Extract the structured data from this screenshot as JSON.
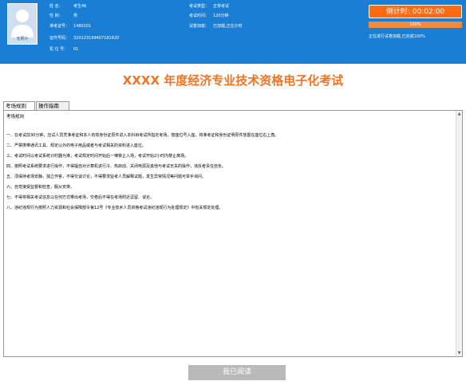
{
  "header": {
    "avatar_label": "无照片",
    "candidate": [
      {
        "key": "姓    名：",
        "value": "考生46"
      },
      {
        "key": "性    别：",
        "value": "男"
      },
      {
        "key": "准考证号：",
        "value": "1480101"
      },
      {
        "key": "证件号码：",
        "value": "320123199407181620"
      },
      {
        "key": "机 位 号：",
        "value": "01"
      }
    ],
    "exam": [
      {
        "key": "考试类型：",
        "value": "正常考试"
      },
      {
        "key": "考试时间：",
        "value": "120分钟"
      },
      {
        "key": "试卷加载：",
        "value": "已加载,正在计时"
      }
    ],
    "timer_label": "倒计时: 00:02:00",
    "progress_label": "100%",
    "progress_fraction": 1.0,
    "status_text": "正在进行试卷加载,已完成100%",
    "colors": {
      "header_bg": "#1a7fd4",
      "accent": "#f5731f"
    }
  },
  "page_title": "XXXX 年度经济专业技术资格电子化考试",
  "tabs": [
    {
      "label": "考场规则"
    },
    {
      "label": "操作指南"
    }
  ],
  "content": {
    "heading": "考场规则",
    "rules": [
      "一、在考试前30分钟，应试人员凭准考证和本人有效身份证原件进入本科目考试所指定考场，按座位号入座，将准考证和身份证明原件放置在座位右上角。",
      "二、严禁携带通讯工具、规定以外的电子用品或者与考试相关的资料进入座位。",
      "三、考试时间以考试系统计时器为准，考试规定时间开始后一律禁止入场，考试开始2小时内禁止离场。",
      "四、按照考试系统要求进行操作，不得擅自对计算机进行冷、热启动、关闭电源及其他与考试无关的操作，违反者责任自负。",
      "五、须保持考场安静，独立作答，不得交谈讨论，不得要求监考人员解释试题，发生异常情况等问题可举手询问。",
      "六、自觉接受监督和检查，服从安排。",
      "七、不得将相关考试信息以任何方式带出考场，交卷后不得在考场附近逗留、谈论。",
      "八、违纪违规行为按照人力资源和社会保障部令第12号《专业技术人员资格考试违纪违规行为处理规定》中有关规定处理。"
    ]
  },
  "finish_button": "我已阅读"
}
